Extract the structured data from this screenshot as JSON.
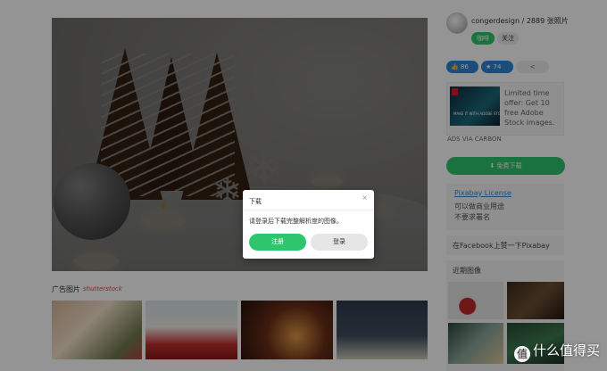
{
  "uploader": {
    "name_stats": "congerdesign / 2889 张照片",
    "coffee_label": "咖啡",
    "follow_label": "关注"
  },
  "stats": {
    "likes": "86",
    "favorites": "74",
    "share_icon": "share-icon"
  },
  "ad": {
    "text": "Limited time offer: Get 10 free Adobe Stock images.",
    "image_caption": "MAKE IT WITH ADOBE STOCK.",
    "via": "ADS VIA CARBON"
  },
  "download": {
    "label": "⬇ 免费下载"
  },
  "license": {
    "link": "Pixabay License",
    "line1": "可以做商业用途",
    "line2": "不要求署名"
  },
  "facebook": {
    "text": "在Facebook上赞一下Pixabay"
  },
  "recent": {
    "title": "近期图像"
  },
  "ad_row": {
    "label": "广告图片",
    "brand": "shutterstock"
  },
  "modal": {
    "title": "下载",
    "close": "×",
    "message": "请登录后下载完整解析度的图像。",
    "register_label": "注册",
    "login_label": "登录"
  },
  "watermark": {
    "badge": "值",
    "text": "什么值得买"
  },
  "colors": {
    "accent_green": "#2ec66d",
    "accent_blue": "#2f86d4",
    "brand_red": "#e2493b"
  }
}
